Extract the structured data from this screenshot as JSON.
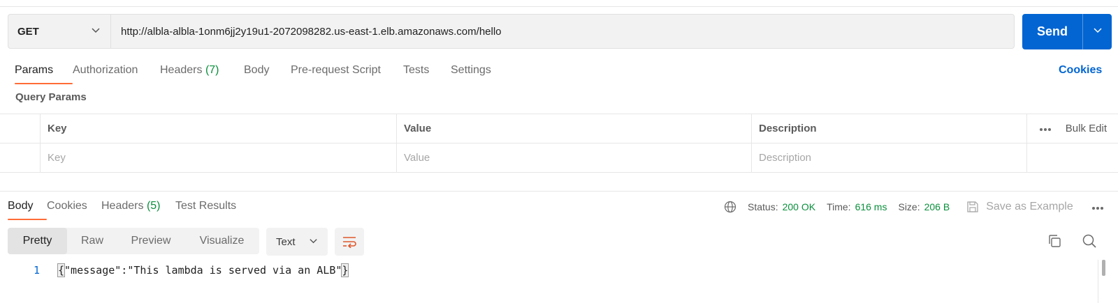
{
  "request": {
    "method": "GET",
    "url": "http://albla-albla-1onm6jj2y19u1-2072098282.us-east-1.elb.amazonaws.com/hello",
    "send_label": "Send"
  },
  "request_tabs": [
    {
      "label": "Params",
      "active": true
    },
    {
      "label": "Authorization"
    },
    {
      "label": "Headers",
      "count": "(7)"
    },
    {
      "label": "Body"
    },
    {
      "label": "Pre-request Script"
    },
    {
      "label": "Tests"
    },
    {
      "label": "Settings"
    }
  ],
  "cookies_link": "Cookies",
  "query_params": {
    "title": "Query Params",
    "columns": {
      "key": "Key",
      "value": "Value",
      "description": "Description",
      "bulk_edit": "Bulk Edit"
    },
    "placeholders": {
      "key": "Key",
      "value": "Value",
      "description": "Description"
    }
  },
  "response_tabs": [
    {
      "label": "Body",
      "active": true
    },
    {
      "label": "Cookies"
    },
    {
      "label": "Headers",
      "count": "(5)"
    },
    {
      "label": "Test Results"
    }
  ],
  "response_meta": {
    "status_label": "Status:",
    "status_value": "200 OK",
    "time_label": "Time:",
    "time_value": "616 ms",
    "size_label": "Size:",
    "size_value": "206 B",
    "save_example": "Save as Example"
  },
  "view_modes": [
    "Pretty",
    "Raw",
    "Preview",
    "Visualize"
  ],
  "active_view_mode": "Pretty",
  "format": "Text",
  "code": {
    "line_number": "1",
    "open_brace": "{",
    "body": "\"message\":\"This lambda is served via an ALB\"",
    "close_brace": "}"
  },
  "colors": {
    "accent_blue": "#0265d2",
    "tab_underline": "#ff6c37",
    "count_green": "#0a8f3c",
    "wrap_icon": "#e0562b"
  },
  "icons": [
    "chevron-down-icon",
    "globe-icon",
    "save-icon",
    "more-icon",
    "wrap-lines-icon",
    "copy-icon",
    "search-icon"
  ]
}
